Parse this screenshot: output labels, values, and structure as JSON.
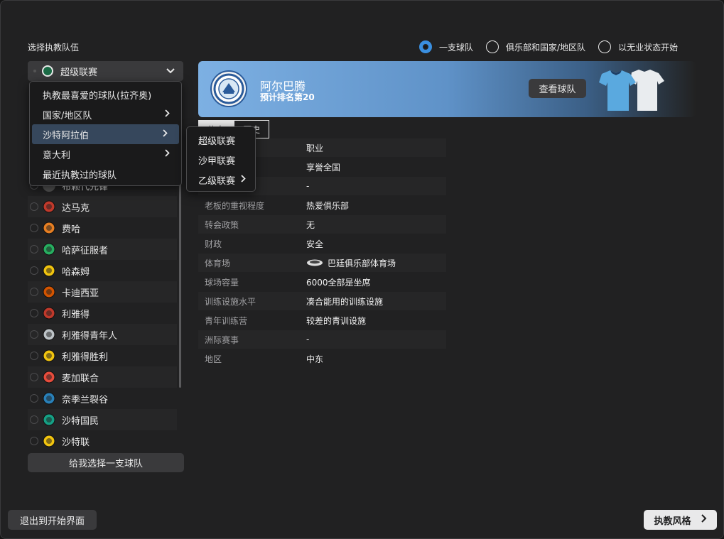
{
  "header": {
    "select_label": "选择执教队伍",
    "modes": [
      {
        "label": "一支球队",
        "checked": true
      },
      {
        "label": "俱乐部和国家/地区队",
        "checked": false
      },
      {
        "label": "以无业状态开始",
        "checked": false
      }
    ]
  },
  "league_select": {
    "value": "超级联赛",
    "icon": "chevron-down-icon"
  },
  "dropdown_menu": {
    "items": [
      {
        "label": "执教最喜爱的球队(拉齐奥)",
        "has_submenu": false
      },
      {
        "label": "国家/地区队",
        "has_submenu": true
      },
      {
        "label": "沙特阿拉伯",
        "has_submenu": true,
        "highlighted": true
      },
      {
        "label": "意大利",
        "has_submenu": true
      },
      {
        "label": "最近执教过的球队",
        "has_submenu": false
      }
    ]
  },
  "submenu": {
    "items": [
      {
        "label": "超级联赛",
        "has_submenu": false
      },
      {
        "label": "沙甲联赛",
        "has_submenu": false
      },
      {
        "label": "乙级联赛",
        "has_submenu": true
      }
    ]
  },
  "team_list": {
    "partial_top_label": "布赖代先锋",
    "teams": [
      {
        "name": "达马克",
        "color": "#c0392b"
      },
      {
        "name": "费哈",
        "color": "#e67e22"
      },
      {
        "name": "哈萨征服者",
        "color": "#27ae60"
      },
      {
        "name": "哈森姆",
        "color": "#f1c40f"
      },
      {
        "name": "卡迪西亚",
        "color": "#d35400"
      },
      {
        "name": "利雅得",
        "color": "#c0392b"
      },
      {
        "name": "利雅得青年人",
        "color": "#bdc3c7"
      },
      {
        "name": "利雅得胜利",
        "color": "#f1c40f"
      },
      {
        "name": "麦加联合",
        "color": "#e74c3c"
      },
      {
        "name": "奈季兰裂谷",
        "color": "#2980b9"
      },
      {
        "name": "沙特国民",
        "color": "#16a085"
      },
      {
        "name": "沙特联",
        "color": "#f1c40f"
      }
    ]
  },
  "choose_button": "给我选择一支球队",
  "club": {
    "name": "阿尔巴腾",
    "rank": "预计排名第20",
    "view_button": "查看球队",
    "crest_text": "ALBATIN CLUB",
    "home_kit_color": "#5aa9df",
    "away_kit_color": "#e9ecef"
  },
  "tabs": [
    "信息",
    "历史"
  ],
  "details": [
    {
      "label": "",
      "value": "职业"
    },
    {
      "label": "",
      "value": "享誉全国"
    },
    {
      "label": "",
      "value": "-"
    },
    {
      "label": "老板的重视程度",
      "value": "热爱俱乐部"
    },
    {
      "label": "转会政策",
      "value": "无"
    },
    {
      "label": "财政",
      "value": "安全"
    },
    {
      "label": "体育场",
      "value": "巴廷俱乐部体育场",
      "icon": "stadium-icon"
    },
    {
      "label": "球场容量",
      "value": "6000全部是坐席"
    },
    {
      "label": "训练设施水平",
      "value": "凑合能用的训练设施"
    },
    {
      "label": "青年训练营",
      "value": "较差的青训设施"
    },
    {
      "label": "洲际赛事",
      "value": "-"
    },
    {
      "label": "地区",
      "value": "中东"
    }
  ],
  "footer": {
    "exit_button": "退出到开始界面",
    "style_button": "执教风格"
  }
}
